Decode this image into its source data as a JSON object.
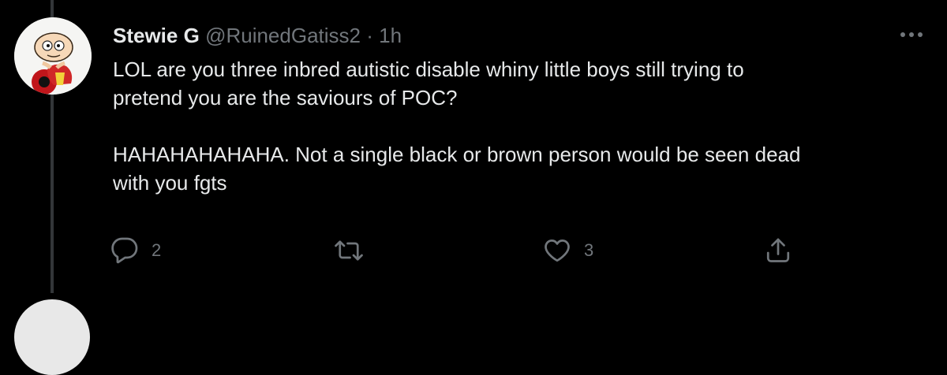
{
  "tweet": {
    "display_name": "Stewie G",
    "handle": "@RuinedGatiss2",
    "separator": "·",
    "time": "1h",
    "text_lines": [
      "LOL are you three inbred autistic disable whiny little boys still trying to",
      "pretend you are the saviours of POC?",
      "HAHAHAHAHAHA. Not a single black or brown person would be seen dead",
      "with you fgts"
    ],
    "actions": {
      "reply_count": "2",
      "retweet_count": "",
      "like_count": "3"
    }
  },
  "icons": {
    "more": "more-horizontal-icon",
    "reply": "reply-icon",
    "retweet": "retweet-icon",
    "like": "heart-icon",
    "share": "share-icon"
  },
  "colors": {
    "background": "#000000",
    "text_primary": "#e7e9ea",
    "text_secondary": "#71767b",
    "thread_line": "#333639"
  }
}
